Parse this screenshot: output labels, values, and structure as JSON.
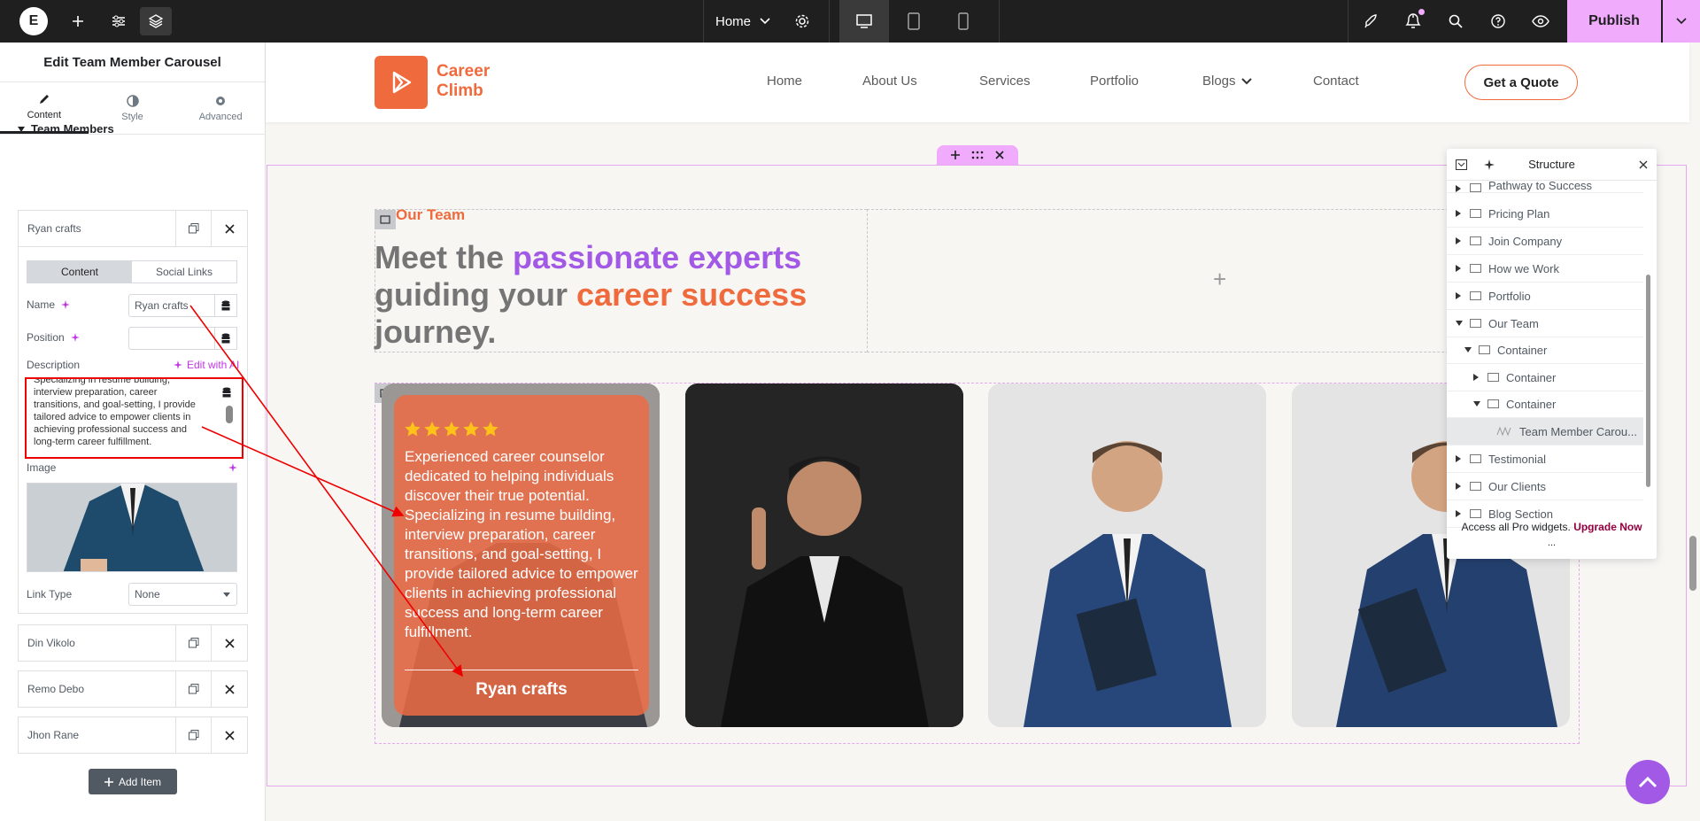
{
  "topbar": {
    "logo": "E",
    "page_name": "Home",
    "publish_label": "Publish"
  },
  "panel": {
    "title": "Edit Team Member Carousel",
    "tabs": [
      {
        "label": "Content",
        "icon": "pencil-icon"
      },
      {
        "label": "Style",
        "icon": "half-circle-icon"
      },
      {
        "label": "Advanced",
        "icon": "gear-icon"
      }
    ],
    "section_title": "Team Members",
    "items": [
      "Ryan crafts",
      "Din Vikolo",
      "Remo Debo",
      "Jhon Rane"
    ],
    "subtabs": [
      "Content",
      "Social Links"
    ],
    "name_label": "Name",
    "name_value": "Ryan crafts",
    "position_label": "Position",
    "position_value": "",
    "description_label": "Description",
    "edit_ai_label": "Edit with AI",
    "description_value": "Specializing in resume building, interview preparation, career transitions, and goal-setting, I provide tailored advice to empower clients in achieving professional success and long-term career fulfillment.",
    "image_label": "Image",
    "link_type_label": "Link Type",
    "link_type_value": "None",
    "add_item_label": "Add Item"
  },
  "site": {
    "logo_line1": "Career",
    "logo_line2": "Climb",
    "nav": [
      "Home",
      "About Us",
      "Services",
      "Portfolio",
      "Blogs",
      "Contact"
    ],
    "cta": "Get a Quote",
    "eyebrow": "Our Team",
    "heading_parts": [
      "Meet the ",
      "passionate experts",
      " guiding your ",
      "career success",
      " journey."
    ],
    "card_text": "Experienced career counselor dedicated to helping individuals discover their true potential. Specializing in resume building, interview preparation, career transitions, and goal-setting, I provide tailored advice to empower clients in achieving professional success and long-term career fulfillment.",
    "card_name": "Ryan crafts",
    "rating": 5,
    "accent_orange": "#ef6a3c",
    "accent_purple": "#a259e6"
  },
  "structure": {
    "title": "Structure",
    "rows": [
      "Pathway to Success",
      "Pricing Plan",
      "Join Company",
      "How we Work",
      "Portfolio",
      "Our Team",
      "Container",
      "Container",
      "Container",
      "Team Member Carou...",
      "Testimonial",
      "Our Clients",
      "Blog Section"
    ],
    "footer_text": "Access all Pro widgets.",
    "footer_link": "Upgrade Now",
    "more": "..."
  }
}
